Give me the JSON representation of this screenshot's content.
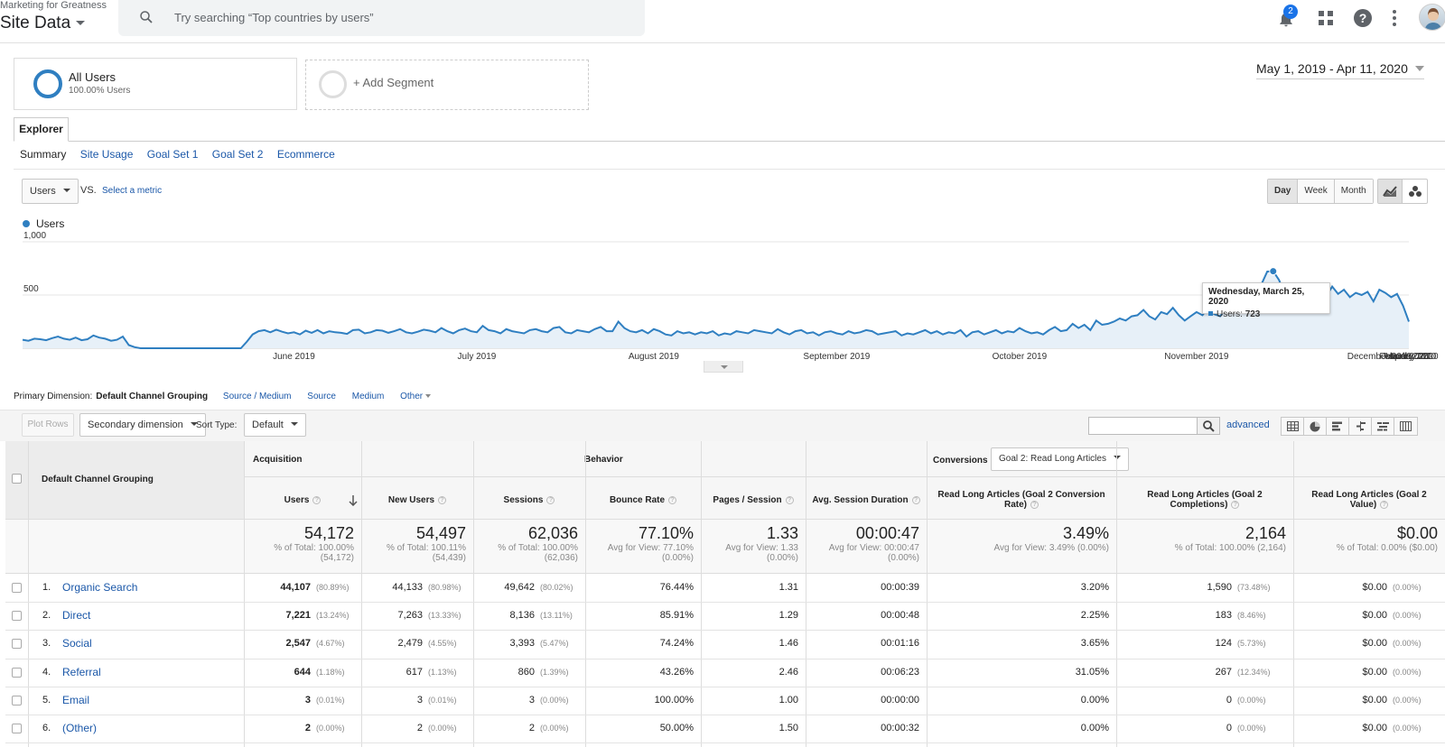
{
  "header": {
    "account": "Marketing for Greatness",
    "property": "Site Data",
    "search_placeholder": "Try searching “Top countries by users”",
    "notifications_count": "2"
  },
  "segments": {
    "active_title": "All Users",
    "active_sub": "100.00% Users",
    "add_label": "+ Add Segment"
  },
  "date_range": "May 1, 2019 - Apr 11, 2020",
  "explorer_tab": "Explorer",
  "subtabs": [
    "Summary",
    "Site Usage",
    "Goal Set 1",
    "Goal Set 2",
    "Ecommerce"
  ],
  "metric": {
    "selected": "Users",
    "vs": "VS.",
    "select_metric": "Select a metric"
  },
  "granularity": [
    "Day",
    "Week",
    "Month"
  ],
  "chart_data": {
    "type": "line",
    "legend": "Users",
    "y_ticks": [
      "1,000",
      "500"
    ],
    "ylim": [
      0,
      1000
    ],
    "x_labels": [
      "June 2019",
      "July 2019",
      "August 2019",
      "September 2019",
      "October 2019",
      "November 2019",
      "December 2019",
      "January 2020",
      "February 2020",
      "March 2020",
      "April 2020"
    ],
    "series": [
      {
        "values": [
          80,
          70,
          90,
          85,
          75,
          95,
          110,
          90,
          80,
          100,
          75,
          85,
          120,
          100,
          90,
          70,
          80,
          110,
          30,
          10,
          0,
          0,
          0,
          0,
          0,
          0,
          0,
          0,
          0,
          0,
          0,
          0,
          0,
          0,
          0,
          0,
          0,
          0,
          60,
          130,
          160,
          170,
          150,
          175,
          155,
          140,
          150,
          130,
          165,
          145,
          170,
          140,
          160,
          150,
          145,
          135,
          170,
          175,
          140,
          150,
          170,
          165,
          145,
          160,
          180,
          150,
          140,
          155,
          175,
          165,
          150,
          190,
          160,
          140,
          170,
          185,
          160,
          150,
          210,
          170,
          160,
          140,
          180,
          160,
          150,
          140,
          170,
          180,
          160,
          150,
          190,
          200,
          150,
          140,
          170,
          160,
          150,
          180,
          200,
          160,
          160,
          250,
          190,
          160,
          150,
          170,
          140,
          180,
          160,
          130,
          120,
          160,
          140,
          150,
          130,
          150,
          140,
          160,
          120,
          140,
          130,
          160,
          150,
          140,
          170,
          160,
          150,
          140,
          180,
          150,
          130,
          160,
          170,
          140,
          150,
          120,
          150,
          160,
          140,
          130,
          160,
          140,
          150,
          170,
          160,
          130,
          140,
          150,
          160,
          120,
          140,
          130,
          150,
          170,
          140,
          160,
          130,
          150,
          140,
          170,
          110,
          150,
          160,
          130,
          150,
          170,
          140,
          160,
          150,
          190,
          160,
          140,
          150,
          130,
          170,
          200,
          160,
          170,
          230,
          190,
          220,
          170,
          260,
          220,
          230,
          250,
          280,
          260,
          300,
          310,
          360,
          300,
          270,
          340,
          320,
          380,
          310,
          260,
          300,
          340,
          310,
          380,
          320,
          300,
          370,
          400,
          440,
          390,
          480,
          560,
          600,
          720,
          723,
          640,
          500,
          520,
          560,
          600,
          590,
          540,
          560,
          490,
          580,
          510,
          550,
          480,
          520,
          500,
          530,
          440,
          550,
          520,
          480,
          510,
          400,
          250
        ],
        "start_date": "May 1, 2019"
      }
    ],
    "tooltip": {
      "date": "Wednesday, March 25, 2020",
      "label": "Users:",
      "value": "723"
    }
  },
  "primary_dimension": {
    "label": "Primary Dimension:",
    "active": "Default Channel Grouping",
    "options": [
      "Source / Medium",
      "Source",
      "Medium",
      "Other"
    ]
  },
  "toolbar": {
    "plot_rows": "Plot Rows",
    "secondary_dimension": "Secondary dimension",
    "sort_type_label": "Sort Type:",
    "sort_type": "Default",
    "advanced": "advanced"
  },
  "table": {
    "dimension_header": "Default Channel Grouping",
    "groups": {
      "acquisition": "Acquisition",
      "behavior": "Behavior",
      "conversions": "Conversions",
      "goal_select": "Goal 2: Read Long Articles"
    },
    "columns": [
      "Users",
      "New Users",
      "Sessions",
      "Bounce Rate",
      "Pages / Session",
      "Avg. Session Duration",
      "Read Long Articles (Goal 2 Conversion Rate)",
      "Read Long Articles (Goal 2 Completions)",
      "Read Long Articles (Goal 2 Value)"
    ],
    "totals": [
      {
        "value": "54,172",
        "sub1": "% of Total: 100.00%",
        "sub2": "(54,172)"
      },
      {
        "value": "54,497",
        "sub1": "% of Total: 100.11%",
        "sub2": "(54,439)"
      },
      {
        "value": "62,036",
        "sub1": "% of Total: 100.00%",
        "sub2": "(62,036)"
      },
      {
        "value": "77.10%",
        "sub1": "Avg for View: 77.10%",
        "sub2": "(0.00%)"
      },
      {
        "value": "1.33",
        "sub1": "Avg for View: 1.33",
        "sub2": "(0.00%)"
      },
      {
        "value": "00:00:47",
        "sub1": "Avg for View: 00:00:47",
        "sub2": "(0.00%)"
      },
      {
        "value": "3.49%",
        "sub1": "Avg for View: 3.49% (0.00%)",
        "sub2": ""
      },
      {
        "value": "2,164",
        "sub1": "% of Total: 100.00% (2,164)",
        "sub2": ""
      },
      {
        "value": "$0.00",
        "sub1": "% of Total: 0.00% ($0.00)",
        "sub2": ""
      }
    ],
    "rows": [
      {
        "num": "1.",
        "name": "Organic Search",
        "users": "44,107",
        "users_pct": "(80.89%)",
        "new_users": "44,133",
        "new_users_pct": "(80.98%)",
        "sessions": "49,642",
        "sessions_pct": "(80.02%)",
        "bounce": "76.44%",
        "pps": "1.31",
        "dur": "00:00:39",
        "conv": "3.20%",
        "comp": "1,590",
        "comp_pct": "(73.48%)",
        "val": "$0.00",
        "val_pct": "(0.00%)"
      },
      {
        "num": "2.",
        "name": "Direct",
        "users": "7,221",
        "users_pct": "(13.24%)",
        "new_users": "7,263",
        "new_users_pct": "(13.33%)",
        "sessions": "8,136",
        "sessions_pct": "(13.11%)",
        "bounce": "85.91%",
        "pps": "1.29",
        "dur": "00:00:48",
        "conv": "2.25%",
        "comp": "183",
        "comp_pct": "(8.46%)",
        "val": "$0.00",
        "val_pct": "(0.00%)"
      },
      {
        "num": "3.",
        "name": "Social",
        "users": "2,547",
        "users_pct": "(4.67%)",
        "new_users": "2,479",
        "new_users_pct": "(4.55%)",
        "sessions": "3,393",
        "sessions_pct": "(5.47%)",
        "bounce": "74.24%",
        "pps": "1.46",
        "dur": "00:01:16",
        "conv": "3.65%",
        "comp": "124",
        "comp_pct": "(5.73%)",
        "val": "$0.00",
        "val_pct": "(0.00%)"
      },
      {
        "num": "4.",
        "name": "Referral",
        "users": "644",
        "users_pct": "(1.18%)",
        "new_users": "617",
        "new_users_pct": "(1.13%)",
        "sessions": "860",
        "sessions_pct": "(1.39%)",
        "bounce": "43.26%",
        "pps": "2.46",
        "dur": "00:06:23",
        "conv": "31.05%",
        "comp": "267",
        "comp_pct": "(12.34%)",
        "val": "$0.00",
        "val_pct": "(0.00%)"
      },
      {
        "num": "5.",
        "name": "Email",
        "users": "3",
        "users_pct": "(0.01%)",
        "new_users": "3",
        "new_users_pct": "(0.01%)",
        "sessions": "3",
        "sessions_pct": "(0.00%)",
        "bounce": "100.00%",
        "pps": "1.00",
        "dur": "00:00:00",
        "conv": "0.00%",
        "comp": "0",
        "comp_pct": "(0.00%)",
        "val": "$0.00",
        "val_pct": "(0.00%)"
      },
      {
        "num": "6.",
        "name": "(Other)",
        "users": "2",
        "users_pct": "(0.00%)",
        "new_users": "2",
        "new_users_pct": "(0.00%)",
        "sessions": "2",
        "sessions_pct": "(0.00%)",
        "bounce": "50.00%",
        "pps": "1.50",
        "dur": "00:00:32",
        "conv": "0.00%",
        "comp": "0",
        "comp_pct": "(0.00%)",
        "val": "$0.00",
        "val_pct": "(0.00%)"
      }
    ]
  }
}
